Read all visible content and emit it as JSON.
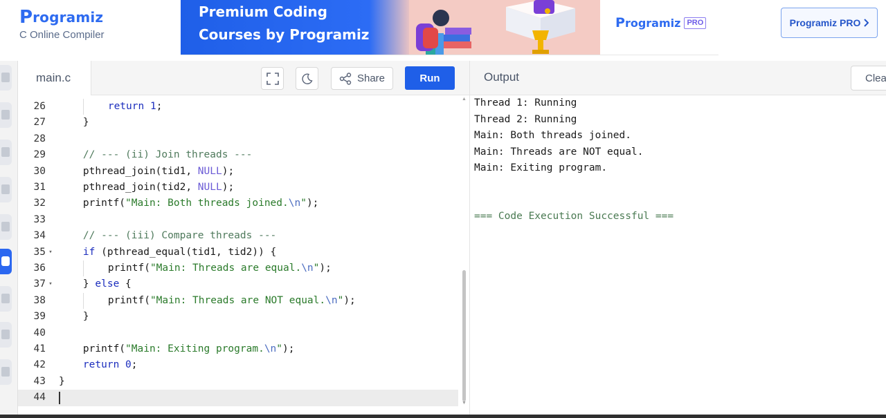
{
  "brand": {
    "logo_p": "P",
    "logo_text": "rogramiz",
    "subtitle": "C Online Compiler"
  },
  "banner": {
    "line1": "Premium Coding",
    "line2": "Courses by Programiz",
    "logo_p": "P",
    "logo_text": "rogramiz",
    "badge": "PRO"
  },
  "header": {
    "pro_button_label": "Programiz PRO",
    "pro_button_icon": "chevron-right-icon"
  },
  "colors": {
    "accent": "#1f5fe8",
    "brand": "#2e6bf0",
    "success_text": "#4a7a52"
  },
  "sidebar": {
    "icons": [
      "python-icon",
      "r-icon",
      "sql-icon",
      "html-icon",
      "typescript-icon",
      "c-icon",
      "cpp-icon",
      "go-icon",
      "swift-icon"
    ],
    "active": "c-icon"
  },
  "editor": {
    "file_tab": "main.c",
    "share_label": "Share",
    "run_label": "Run",
    "current_line": 44,
    "lines": [
      {
        "n": "26",
        "fold": "",
        "tokens": [
          {
            "t": "    ",
            "c": "ind2"
          },
          {
            "t": "return",
            "c": "kw"
          },
          {
            "t": " ",
            "c": ""
          },
          {
            "t": "1",
            "c": "num"
          },
          {
            "t": ";",
            "c": ""
          }
        ]
      },
      {
        "n": "27",
        "fold": "",
        "tokens": [
          {
            "t": "    ",
            "c": "ind1"
          },
          {
            "t": "}",
            "c": ""
          }
        ]
      },
      {
        "n": "28",
        "fold": "",
        "tokens": []
      },
      {
        "n": "29",
        "fold": "",
        "tokens": [
          {
            "t": "    ",
            "c": "ind1"
          },
          {
            "t": "// --- (ii) Join threads ---",
            "c": "cmt"
          }
        ]
      },
      {
        "n": "30",
        "fold": "",
        "tokens": [
          {
            "t": "    ",
            "c": "ind1"
          },
          {
            "t": "pthread_join(tid1, ",
            "c": "fn"
          },
          {
            "t": "NULL",
            "c": "cnst"
          },
          {
            "t": ");",
            "c": ""
          }
        ]
      },
      {
        "n": "31",
        "fold": "",
        "tokens": [
          {
            "t": "    ",
            "c": "ind1"
          },
          {
            "t": "pthread_join(tid2, ",
            "c": "fn"
          },
          {
            "t": "NULL",
            "c": "cnst"
          },
          {
            "t": ");",
            "c": ""
          }
        ]
      },
      {
        "n": "32",
        "fold": "",
        "tokens": [
          {
            "t": "    ",
            "c": "ind1"
          },
          {
            "t": "printf(",
            "c": "fn"
          },
          {
            "t": "\"Main: Both threads joined.",
            "c": "str"
          },
          {
            "t": "\\n",
            "c": "esc"
          },
          {
            "t": "\"",
            "c": "str"
          },
          {
            "t": ");",
            "c": ""
          }
        ]
      },
      {
        "n": "33",
        "fold": "",
        "tokens": []
      },
      {
        "n": "34",
        "fold": "",
        "tokens": [
          {
            "t": "    ",
            "c": "ind1"
          },
          {
            "t": "// --- (iii) Compare threads ---",
            "c": "cmt"
          }
        ]
      },
      {
        "n": "35",
        "fold": "▾",
        "tokens": [
          {
            "t": "    ",
            "c": "ind1"
          },
          {
            "t": "if",
            "c": "kw"
          },
          {
            "t": " (pthread_equal(tid1, tid2)) {",
            "c": ""
          }
        ]
      },
      {
        "n": "36",
        "fold": "",
        "tokens": [
          {
            "t": "    ",
            "c": "ind2"
          },
          {
            "t": "printf(",
            "c": "fn"
          },
          {
            "t": "\"Main: Threads are equal.",
            "c": "str"
          },
          {
            "t": "\\n",
            "c": "esc"
          },
          {
            "t": "\"",
            "c": "str"
          },
          {
            "t": ");",
            "c": ""
          }
        ]
      },
      {
        "n": "37",
        "fold": "▾",
        "tokens": [
          {
            "t": "    ",
            "c": "ind1"
          },
          {
            "t": "} ",
            "c": ""
          },
          {
            "t": "else",
            "c": "kw"
          },
          {
            "t": " {",
            "c": ""
          }
        ]
      },
      {
        "n": "38",
        "fold": "",
        "tokens": [
          {
            "t": "    ",
            "c": "ind2"
          },
          {
            "t": "printf(",
            "c": "fn"
          },
          {
            "t": "\"Main: Threads are NOT equal.",
            "c": "str"
          },
          {
            "t": "\\n",
            "c": "esc"
          },
          {
            "t": "\"",
            "c": "str"
          },
          {
            "t": ");",
            "c": ""
          }
        ]
      },
      {
        "n": "39",
        "fold": "",
        "tokens": [
          {
            "t": "    ",
            "c": "ind1"
          },
          {
            "t": "}",
            "c": ""
          }
        ]
      },
      {
        "n": "40",
        "fold": "",
        "tokens": []
      },
      {
        "n": "41",
        "fold": "",
        "tokens": [
          {
            "t": "    ",
            "c": "ind1"
          },
          {
            "t": "printf(",
            "c": "fn"
          },
          {
            "t": "\"Main: Exiting program.",
            "c": "str"
          },
          {
            "t": "\\n",
            "c": "esc"
          },
          {
            "t": "\"",
            "c": "str"
          },
          {
            "t": ");",
            "c": ""
          }
        ]
      },
      {
        "n": "42",
        "fold": "",
        "tokens": [
          {
            "t": "    ",
            "c": "ind1"
          },
          {
            "t": "return",
            "c": "kw"
          },
          {
            "t": " ",
            "c": ""
          },
          {
            "t": "0",
            "c": "num"
          },
          {
            "t": ";",
            "c": ""
          }
        ]
      },
      {
        "n": "43",
        "fold": "",
        "tokens": [
          {
            "t": "}",
            "c": ""
          }
        ]
      },
      {
        "n": "44",
        "fold": "",
        "tokens": []
      }
    ]
  },
  "output": {
    "title": "Output",
    "clear_label": "Clear",
    "lines": [
      "Thread 1: Running",
      "Thread 2: Running",
      "Main: Both threads joined.",
      "Main: Threads are NOT equal.",
      "Main: Exiting program."
    ],
    "status": "=== Code Execution Successful ==="
  }
}
